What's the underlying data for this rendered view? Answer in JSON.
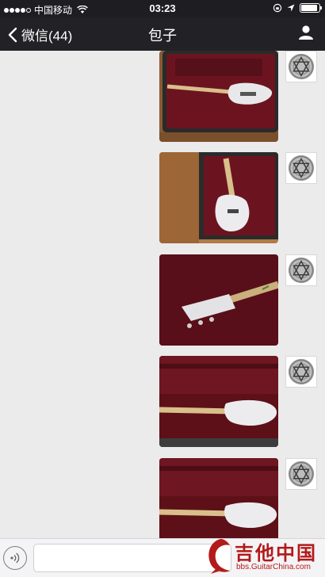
{
  "status_bar": {
    "carrier": "中国移动",
    "time": "03:23",
    "signal_filled": 4,
    "battery_level": 0.92
  },
  "nav": {
    "back_label": "微信(44)",
    "title": "包子"
  },
  "chat": {
    "messages": [
      {
        "type": "image",
        "sender": "self",
        "content": "guitar-in-case-photo"
      },
      {
        "type": "image",
        "sender": "self",
        "content": "guitar-in-case-photo"
      },
      {
        "type": "image",
        "sender": "self",
        "content": "guitar-headstock-photo"
      },
      {
        "type": "image",
        "sender": "self",
        "content": "guitar-in-case-photo"
      },
      {
        "type": "image",
        "sender": "self",
        "content": "guitar-in-case-photo"
      }
    ]
  },
  "input_bar": {
    "voice_icon": "voice-icon",
    "text_value": ""
  },
  "watermark": {
    "title": "吉他中国",
    "subtitle": "bbs.GuitarChina.com"
  },
  "colors": {
    "status_bg": "#1e1e22",
    "nav_bg": "#222226",
    "chat_bg": "#ebebeb",
    "case_velvet": "#6b1420",
    "watermark_red": "#b31a1a"
  }
}
